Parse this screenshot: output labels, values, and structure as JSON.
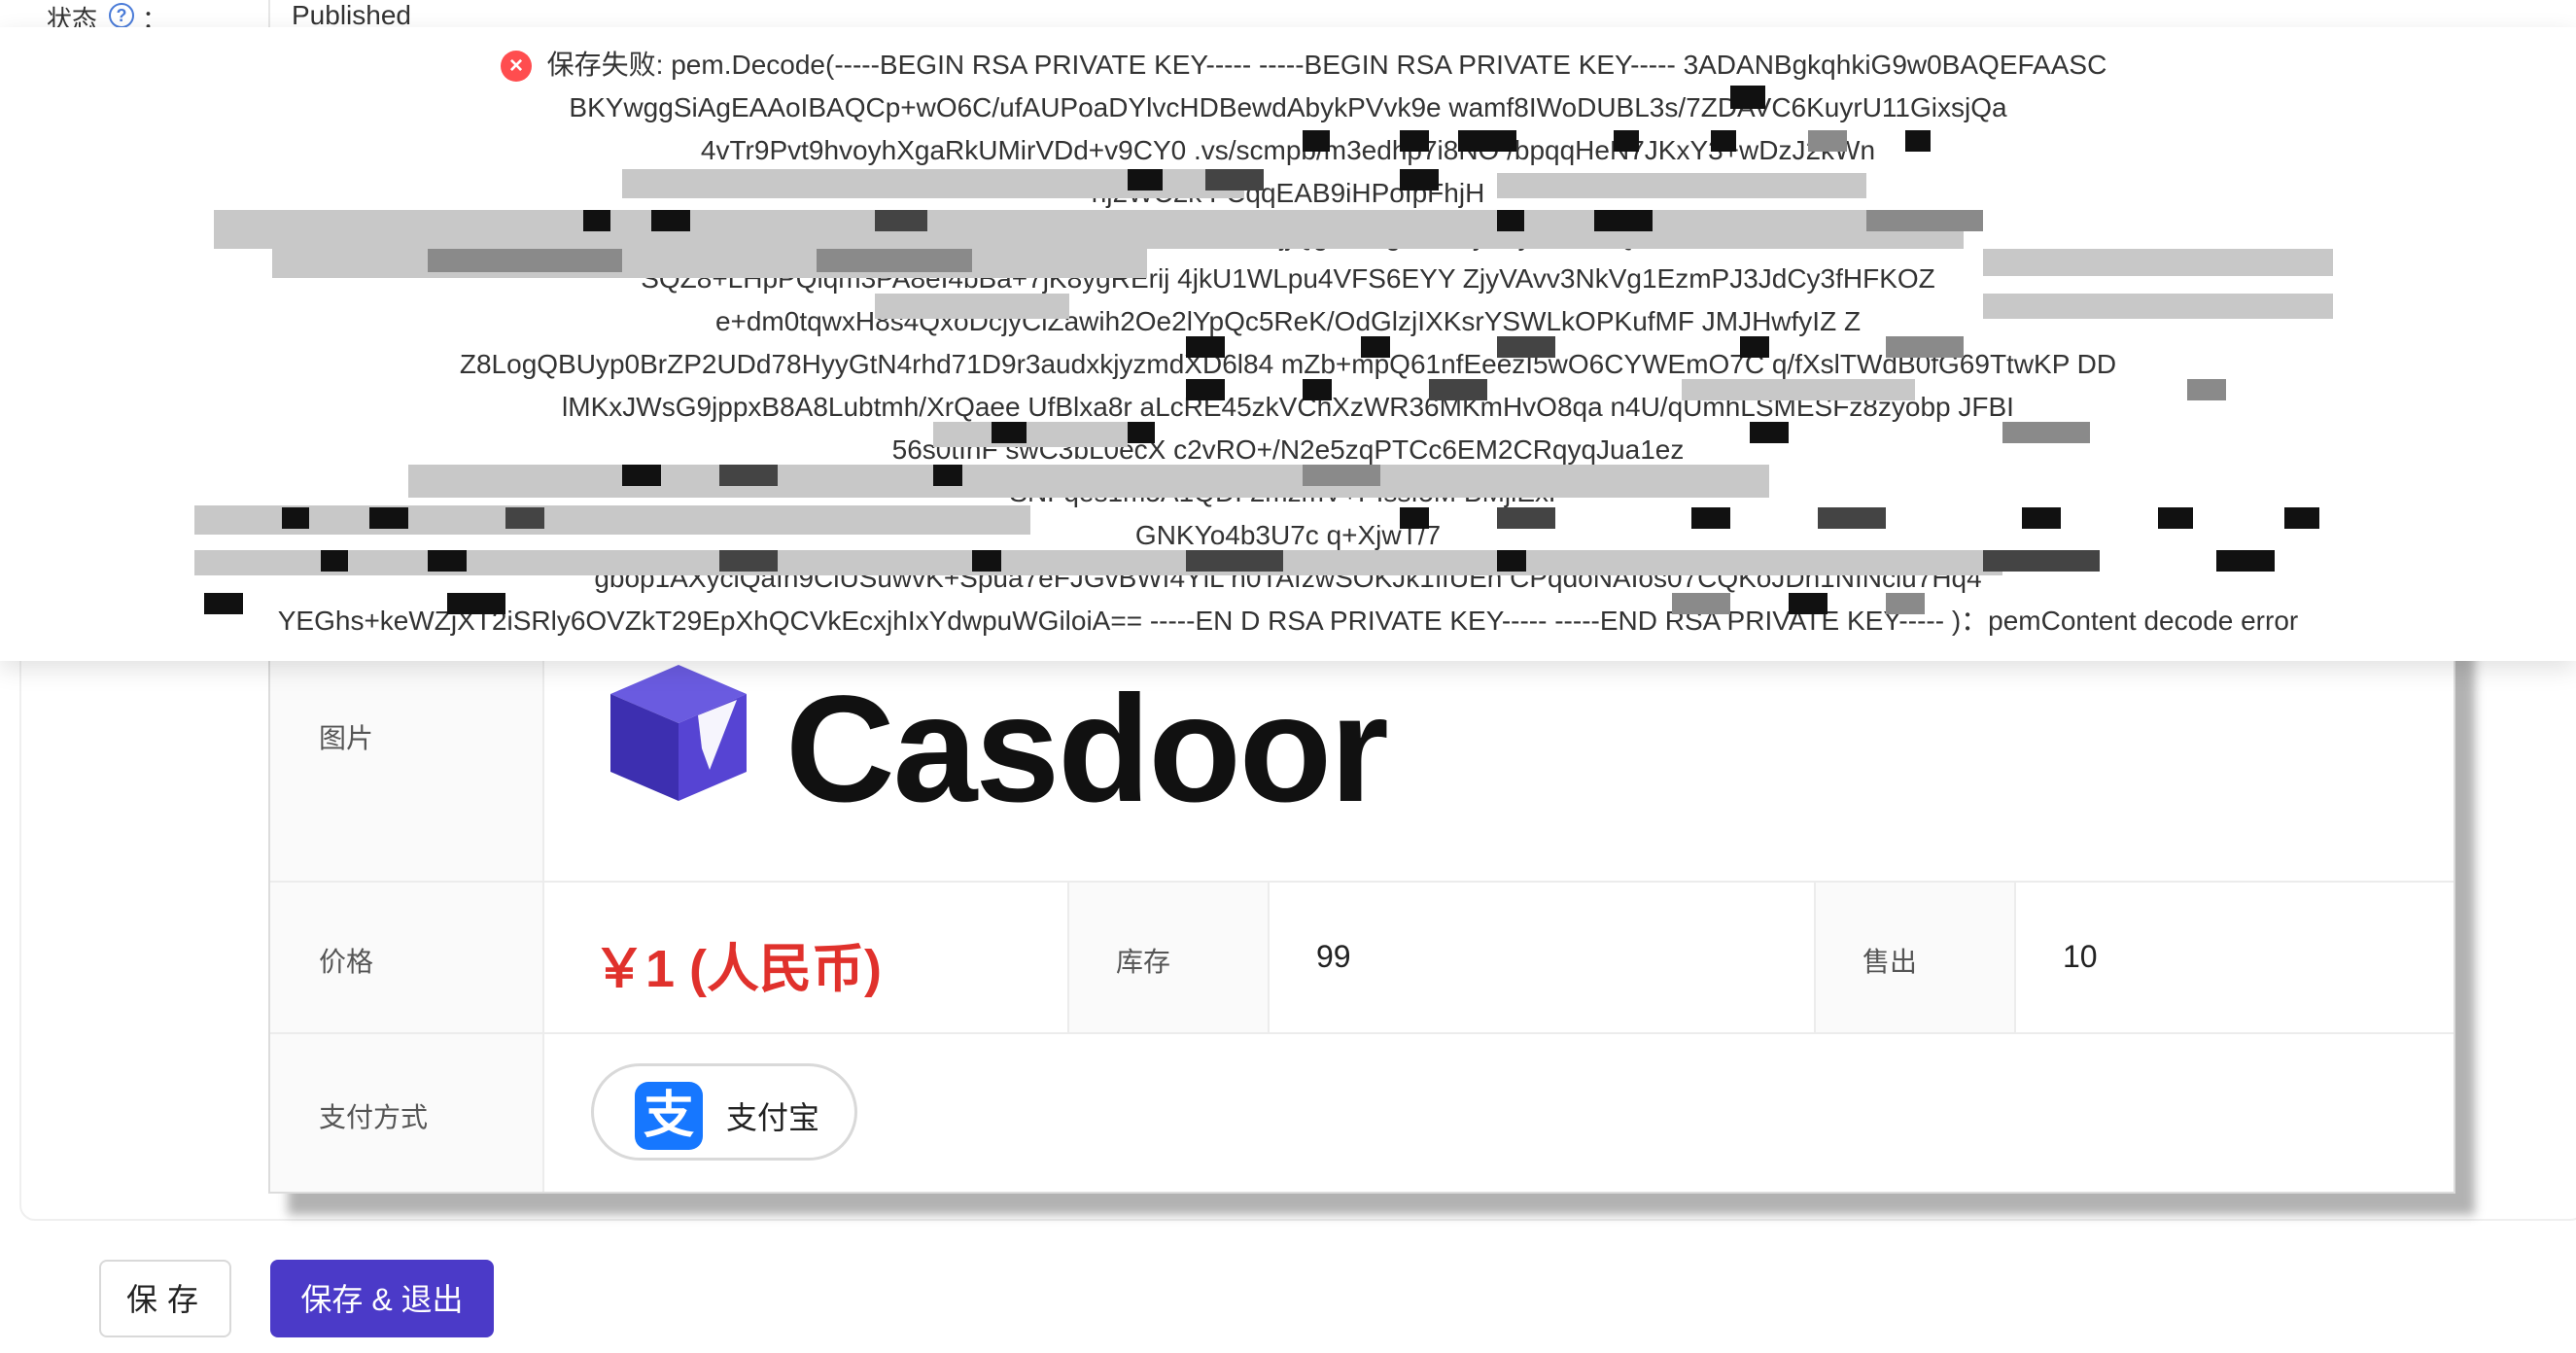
{
  "form": {
    "status_label": "状态",
    "colon": "：",
    "status_value": "Published"
  },
  "error_toast": {
    "lines": [
      "保存失败: pem.Decode(-----BEGIN RSA PRIVATE KEY----- -----BEGIN RSA PRIVATE KEY-----                        3ADANBgkqhkiG9w0BAQEFAASC",
      "BKYwggSiAgEAAoIBAQCp+wO6C/ufAUPoaDYlvcHDBewdAbykPVvk9e                                                          wamf8IWoDUBL3s/7ZDAVC6KuyrU11GixsjQa",
      "4vTr9Pvt9hvoyhXgaRkUMirVDd+v9CY0                                                          .vs/scmpb/m3edhp7i8NO                 /bpqqHeN7JKxY3+wDzJ2kWn",
      "nj2WC2k                                                                                                                                                         FCqqEAB9iHPoIpFhjH",
      "2qVcwr                                                                           NEDKRVx/OEFLlk30jjQgSTMgFCD+yBzynL8XEQL                          ",
      "SQZ8+LHpPQiqm3PA8eI4bBa+7jK8ygRErij               4jkU1WLpu4VFS6EYY ZjyVAvv3NkVg1EzmPJ3JdCy3fHFKOZ                          ",
      "e+dm0tqwxH8s4QxoDcjyClZawih2Oe2lYpQc5ReK/OdGlzjIXKsrYSWLkOPKufMF                                                          JMJHwfyIZ         Z",
      "Z8LogQBUyp0BrZP2UDd78HyyGtN4rhd71D9r3audxkjyzmdXD6l84                    mZb+mpQ61nfEeezI5wO6CYWEmO7C                  q/fXslTWdB0fG69TtwKP           DD",
      "lMKxJWsG9jppxB8A8Lubtmh/XrQaee                             UfBlxa8r aLcRE45zkVChXzWR36MKmHvO8qa                   n4U/qUmhLSMESFz8zyobp              JFBI",
      "56s0tIhF                                                                            swC3bL0ecX                         c2vRO+/N2e5zqPTCc6EM2CRqyqJua1ez",
      "                        SNFqes1m5A1QDI 2mzmV+PIssf5M                                                                                         BMjiExP",
      "                                                                                                                           GNKYo4b3U7c                            q+XjwT/7",
      "                                    gbop1AXyclQafn9ClUSuwvK+Spua7eFJGvBWf4YlL n0TAfzwSOKJk1ffUEh                          CPqdoNAIos07CQKoJDn1NINciu7Hq4",
      "YEGhs+keWZjXT2iSRly6OVZkT29EpXhQCVkEcxjhIxYdwpuWGiloiA== -----EN D RSA PRIVATE KEY----- -----END RSA PRIVATE KEY----- )：pemContent decode error"
    ]
  },
  "product": {
    "image_label": "图片",
    "brand_name": "Casdoor",
    "price_label": "价格",
    "price_value": "￥1 (人民币)",
    "stock_label": "库存",
    "stock_value": "99",
    "sold_label": "售出",
    "sold_value": "10",
    "payment_label": "支付方式",
    "payment_method": "支付宝",
    "payment_icon_glyph": "支"
  },
  "buttons": {
    "save": "保存",
    "save_exit": "保存 & 退出"
  },
  "colors": {
    "accent": "#4b3ac8",
    "price": "#e0312c",
    "error": "#ff4d4f",
    "alipay": "#1677ff"
  },
  "icons": {
    "help": "question-circle-icon",
    "error": "close-circle-icon",
    "alipay": "alipay-icon",
    "logo": "casdoor-cube-logo"
  }
}
